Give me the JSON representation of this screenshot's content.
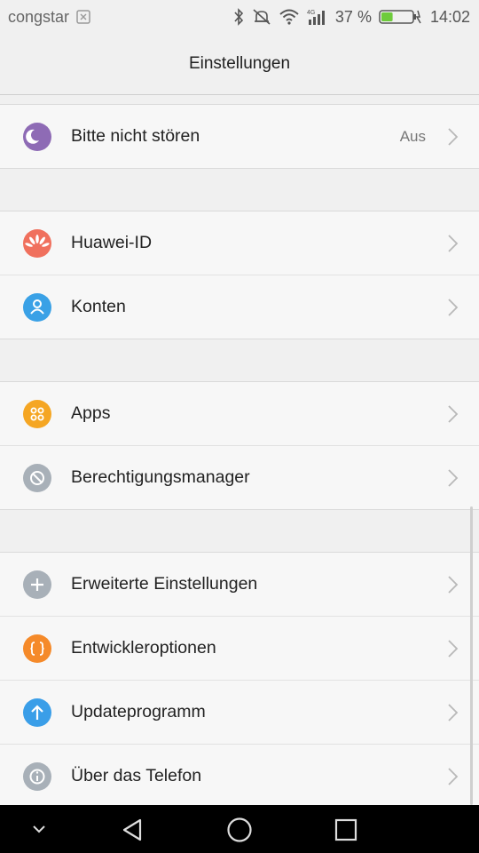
{
  "status_bar": {
    "carrier": "congstar",
    "battery_percent": "37 %",
    "time": "14:02",
    "icons": [
      "sim-icon",
      "bluetooth-icon",
      "alarm-off-icon",
      "wifi-icon",
      "signal-icon",
      "battery-icon"
    ],
    "battery_level": 0.37
  },
  "header": {
    "title": "Einstellungen"
  },
  "groups": [
    {
      "items": [
        {
          "label": "Bitte nicht stören",
          "value": "Aus",
          "icon": "moon-icon",
          "color": "#8e6bb5"
        }
      ]
    },
    {
      "items": [
        {
          "label": "Huawei-ID",
          "icon": "huawei-icon",
          "color": "#f0705d"
        },
        {
          "label": "Konten",
          "icon": "account-icon",
          "color": "#3aa1e6"
        }
      ]
    },
    {
      "items": [
        {
          "label": "Apps",
          "icon": "apps-icon",
          "color": "#f5a623"
        },
        {
          "label": "Berechtigungsmanager",
          "icon": "permission-icon",
          "color": "#a8b0b8"
        }
      ]
    },
    {
      "items": [
        {
          "label": "Erweiterte Einstellungen",
          "icon": "plus-icon",
          "color": "#a8b0b8"
        },
        {
          "label": "Entwickleroptionen",
          "icon": "braces-icon",
          "color": "#f58a2a"
        },
        {
          "label": "Updateprogramm",
          "icon": "arrow-up-icon",
          "color": "#3a9ee8"
        },
        {
          "label": "Über das Telefon",
          "icon": "info-icon",
          "color": "#a8b0b8"
        }
      ]
    }
  ],
  "nav_bar": {
    "icons": [
      "collapse-icon",
      "back-icon",
      "home-icon",
      "recents-icon"
    ]
  }
}
